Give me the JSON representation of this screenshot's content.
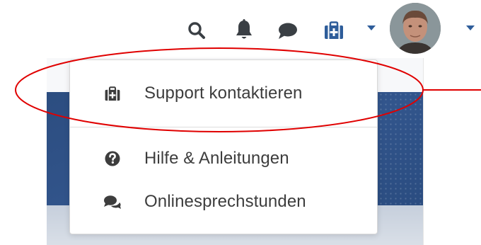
{
  "navbar": {
    "icons": [
      "search-icon",
      "bell-icon",
      "chat-bubble-icon",
      "medical-kit-icon",
      "caret-down-icon",
      "avatar",
      "caret-down-icon"
    ],
    "icon_color": "#3a3f44",
    "caret_color": "#2e5d9a"
  },
  "dropdown": {
    "items": [
      {
        "label": "Support kontaktieren",
        "icon": "medical-kit-icon"
      },
      {
        "label": "Hilfe & Anleitungen",
        "icon": "question-circle-icon"
      },
      {
        "label": "Onlinesprechstunden",
        "icon": "comments-icon"
      }
    ]
  },
  "annotation": {
    "color": "#e00000",
    "shape": "ellipse-with-pointer"
  },
  "background": {
    "banner_color": "#2e5086"
  }
}
